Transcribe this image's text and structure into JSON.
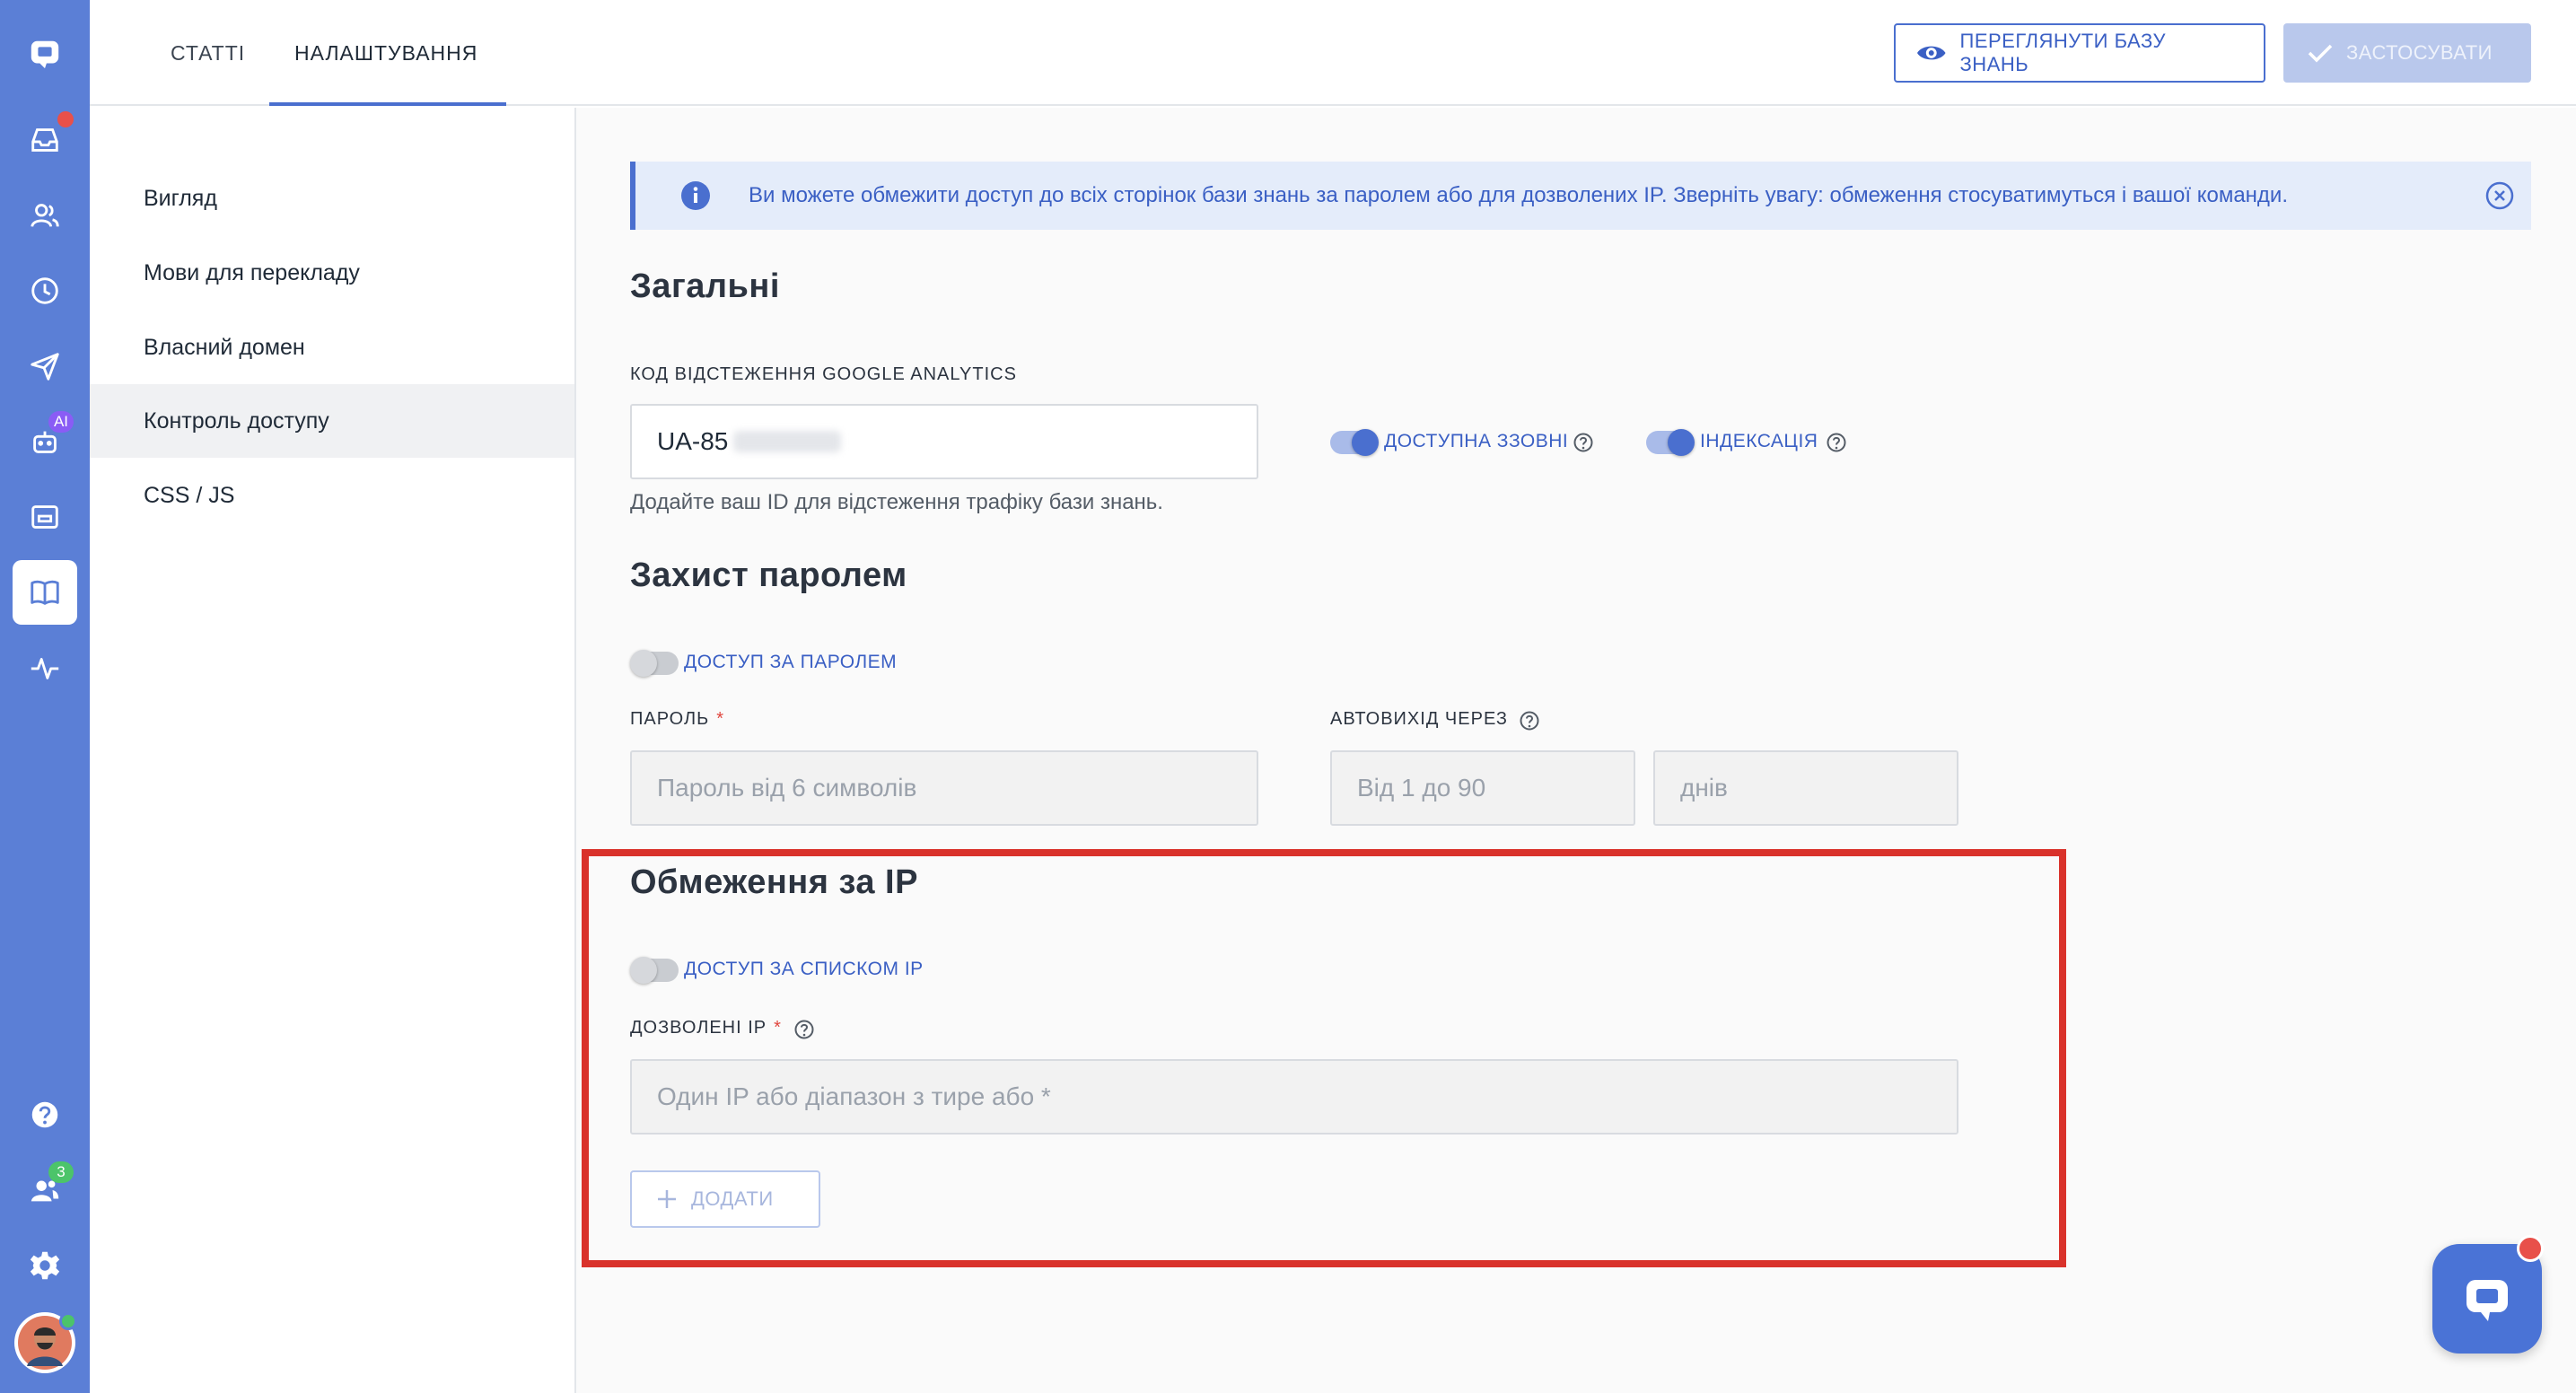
{
  "topbar": {
    "tabs": [
      {
        "label": "СТАТТІ"
      },
      {
        "label": "НАЛАШТУВАННЯ"
      }
    ],
    "view_kb_label": "ПЕРЕГЛЯНУТИ БАЗУ ЗНАНЬ",
    "apply_label": "ЗАСТОСУВАТИ"
  },
  "rail": {
    "colors": {
      "bg": "#5b7fd6",
      "notify_dot": "#e8504a",
      "ai_badge": "#8a5cf5",
      "online": "#4cc46a"
    },
    "ai_badge": "AI",
    "team_count": "3"
  },
  "subnav": {
    "items": [
      {
        "label": "Вигляд"
      },
      {
        "label": "Мови для перекладу"
      },
      {
        "label": "Власний домен"
      },
      {
        "label": "Контроль доступу"
      },
      {
        "label": "CSS / JS"
      }
    ]
  },
  "main": {
    "info_text": "Ви можете обмежити доступ до всіх сторінок бази знань за паролем або для дозволених IP. Зверніть увагу: обмеження стосуватимуться і вашої команди.",
    "general": {
      "title": "Загальні",
      "ga_label": "КОД ВІДСТЕЖЕННЯ GOOGLE ANALYTICS",
      "ga_value": "UA-85",
      "ga_hint": "Додайте ваш ID для відстеження трафіку бази знань.",
      "public_toggle_label": "ДОСТУПНА ЗЗОВНІ",
      "indexing_toggle_label": "ІНДЕКСАЦІЯ"
    },
    "password": {
      "title": "Захист паролем",
      "toggle_label": "ДОСТУП ЗА ПАРОЛЕМ",
      "password_label": "ПАРОЛЬ",
      "required_mark": "*",
      "password_placeholder": "Пароль від 6 символів",
      "logout_label": "АВТОВИХІД ЧЕРЕЗ",
      "logout_placeholder": "Від 1 до 90",
      "days_placeholder": "днів"
    },
    "ip": {
      "title": "Обмеження за IP",
      "toggle_label": "ДОСТУП ЗА СПИСКОМ IP",
      "allowed_label": "ДОЗВОЛЕНІ IP",
      "required_mark": "*",
      "ip_placeholder": "Один IP або діапазон з тире або *",
      "add_label": "ДОДАТИ"
    }
  }
}
